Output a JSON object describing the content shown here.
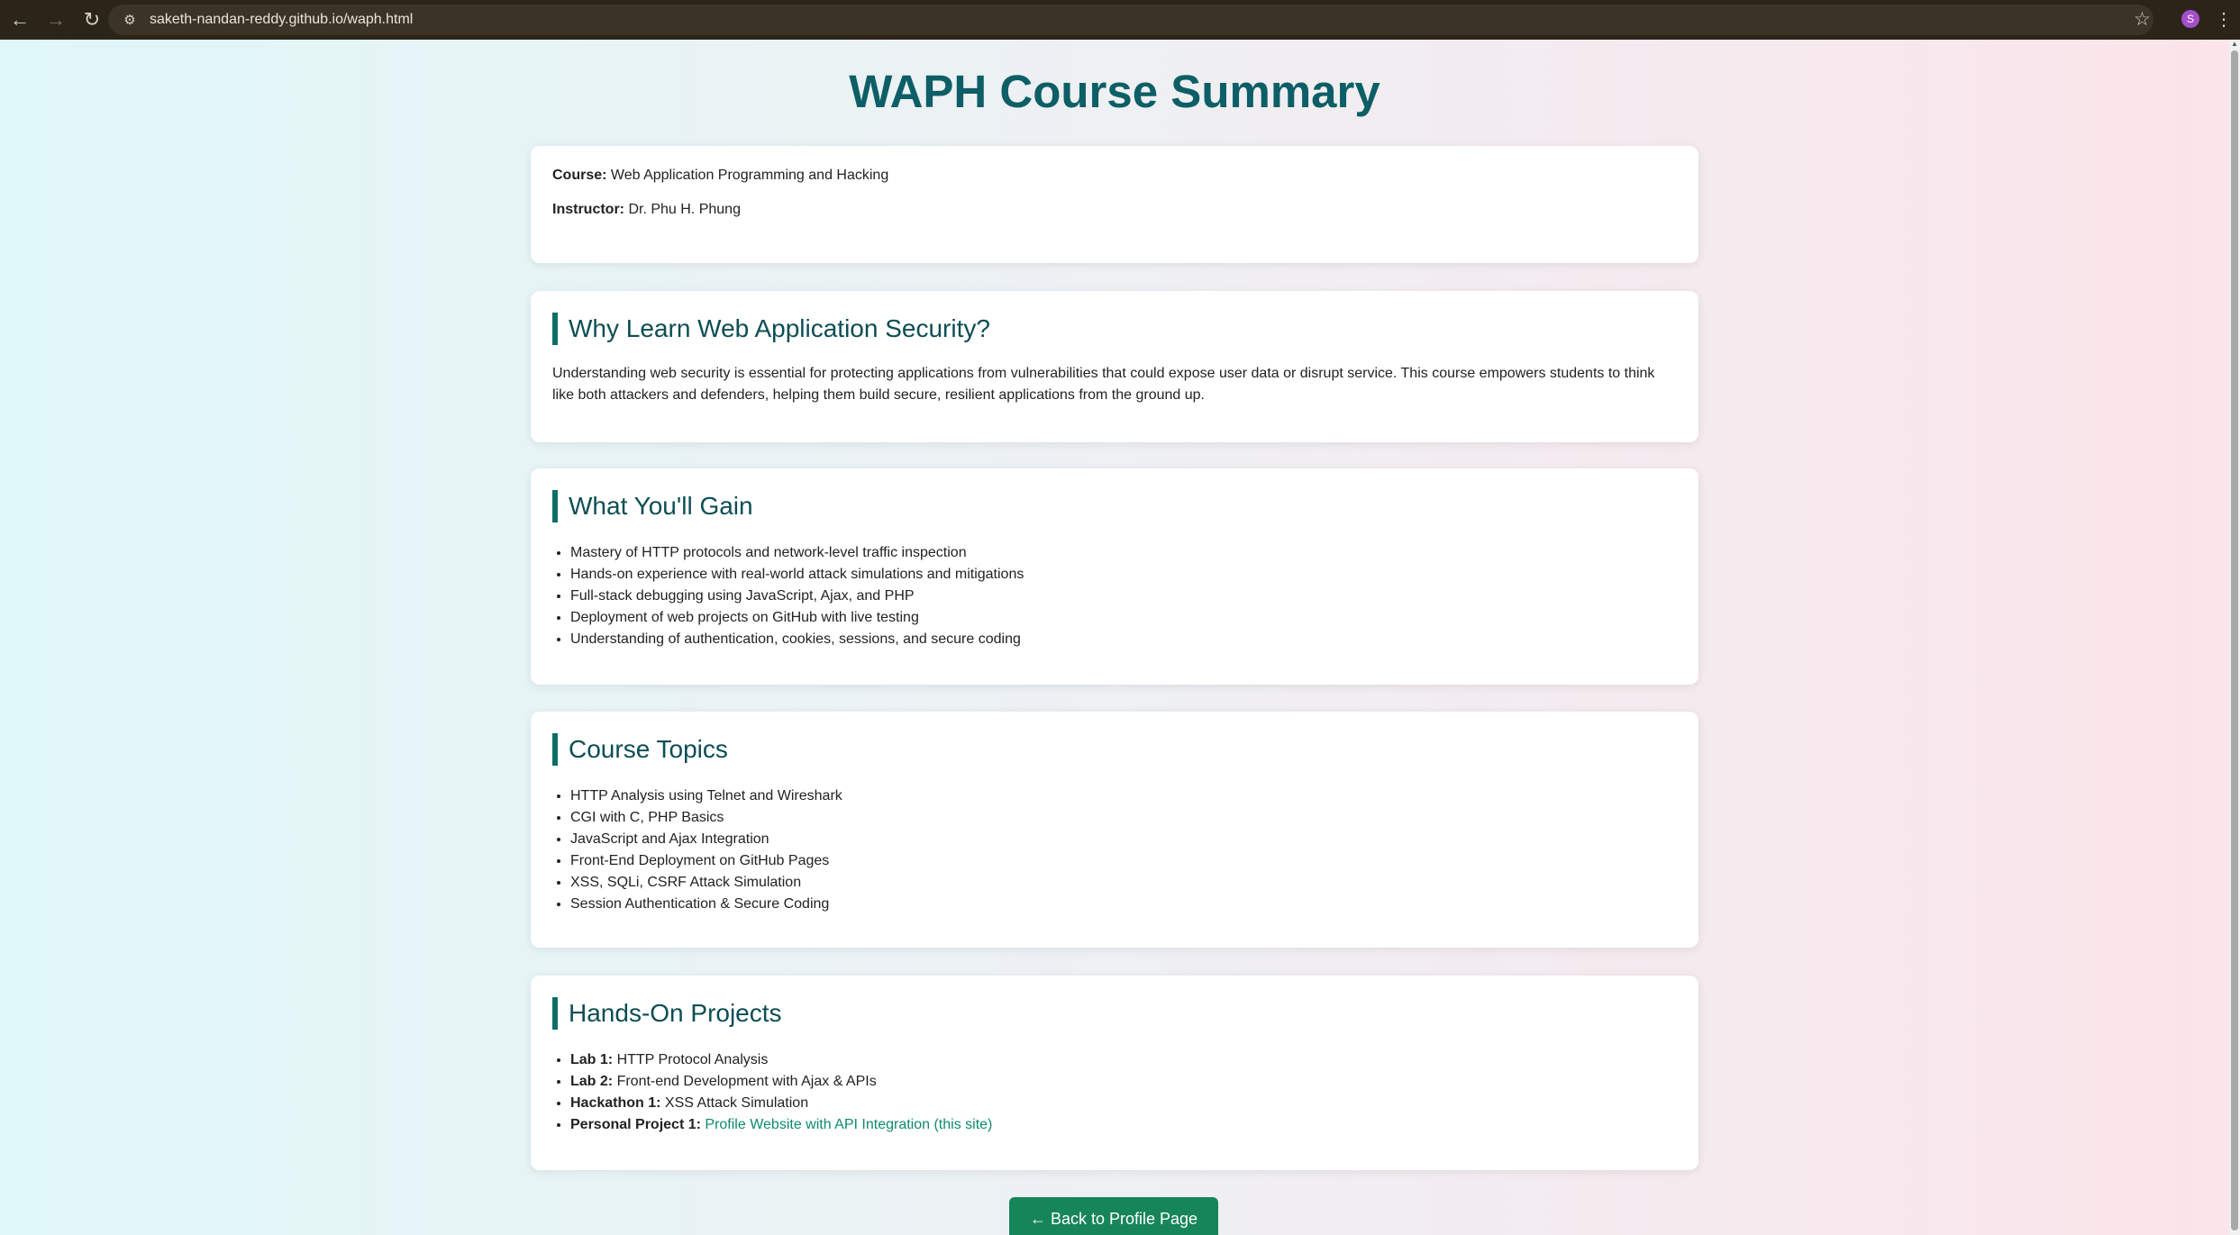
{
  "browser": {
    "url": "saketh-nandan-reddy.github.io/waph.html",
    "avatar_letter": "S"
  },
  "page": {
    "title": "WAPH Course Summary",
    "info": {
      "course_label": "Course:",
      "course_value": " Web Application Programming and Hacking",
      "instructor_label": "Instructor:",
      "instructor_value": " Dr. Phu H. Phung"
    },
    "why": {
      "title": "Why Learn Web Application Security?",
      "text": "Understanding web security is essential for protecting applications from vulnerabilities that could expose user data or disrupt service. This course empowers students to think like both attackers and defenders, helping them build secure, resilient applications from the ground up."
    },
    "gain": {
      "title": "What You'll Gain",
      "items": [
        "Mastery of HTTP protocols and network-level traffic inspection",
        "Hands-on experience with real-world attack simulations and mitigations",
        "Full-stack debugging using JavaScript, Ajax, and PHP",
        "Deployment of web projects on GitHub with live testing",
        "Understanding of authentication, cookies, sessions, and secure coding"
      ]
    },
    "topics": {
      "title": "Course Topics",
      "items": [
        "HTTP Analysis using Telnet and Wireshark",
        "CGI with C, PHP Basics",
        "JavaScript and Ajax Integration",
        "Front-End Deployment on GitHub Pages",
        "XSS, SQLi, CSRF Attack Simulation",
        "Session Authentication & Secure Coding"
      ]
    },
    "projects": {
      "title": "Hands-On Projects",
      "items": [
        {
          "label": "Lab 1:",
          "text": " HTTP Protocol Analysis"
        },
        {
          "label": "Lab 2:",
          "text": " Front-end Development with Ajax & APIs"
        },
        {
          "label": "Hackathon 1:",
          "text": " XSS Attack Simulation"
        },
        {
          "label": "Personal Project 1:",
          "link": "Profile Website with API Integration (this site)"
        }
      ]
    },
    "back_button": "← Back to Profile Page"
  }
}
